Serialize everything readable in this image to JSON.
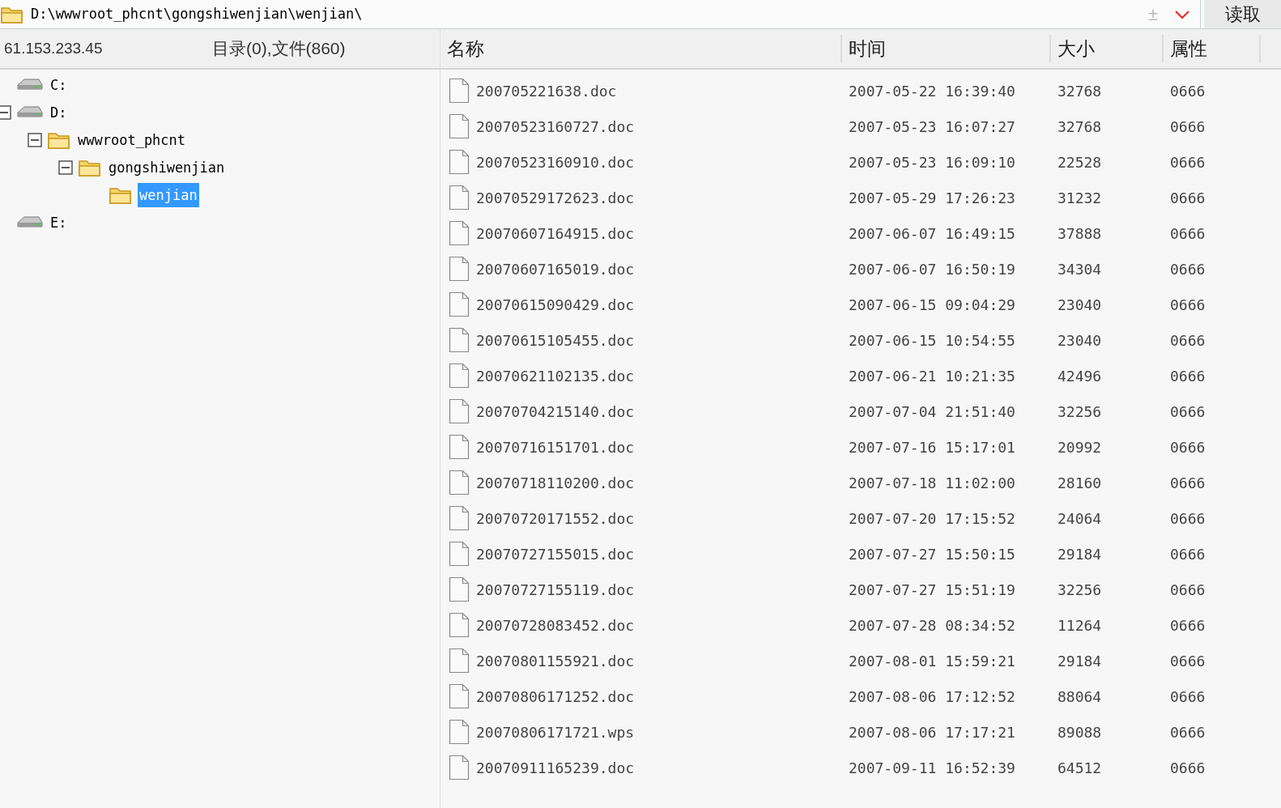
{
  "address_bar": {
    "path": "D:\\wwwroot_phcnt\\gongshiwenjian\\wenjian\\",
    "toggle_symbol": "±",
    "read_button": "读取"
  },
  "left_header": {
    "host": "61.153.233.45",
    "summary": "目录(0),文件(860)"
  },
  "tree": [
    {
      "label": "C:",
      "kind": "drive",
      "expanded": false,
      "selected": false
    },
    {
      "label": "D:",
      "kind": "drive",
      "expanded": true,
      "selected": false,
      "children": [
        {
          "label": "wwwroot_phcnt",
          "kind": "folder",
          "expanded": true,
          "selected": false,
          "children": [
            {
              "label": "gongshiwenjian",
              "kind": "folder",
              "expanded": true,
              "selected": false,
              "children": [
                {
                  "label": "wenjian",
                  "kind": "folder",
                  "expanded": false,
                  "selected": true
                }
              ]
            }
          ]
        }
      ]
    },
    {
      "label": "E:",
      "kind": "drive",
      "expanded": false,
      "selected": false
    }
  ],
  "table": {
    "columns": [
      "名称",
      "时间",
      "大小",
      "属性"
    ],
    "rows": [
      [
        "200705221638.doc",
        "2007-05-22 16:39:40",
        "32768",
        "0666"
      ],
      [
        "20070523160727.doc",
        "2007-05-23 16:07:27",
        "32768",
        "0666"
      ],
      [
        "20070523160910.doc",
        "2007-05-23 16:09:10",
        "22528",
        "0666"
      ],
      [
        "20070529172623.doc",
        "2007-05-29 17:26:23",
        "31232",
        "0666"
      ],
      [
        "20070607164915.doc",
        "2007-06-07 16:49:15",
        "37888",
        "0666"
      ],
      [
        "20070607165019.doc",
        "2007-06-07 16:50:19",
        "34304",
        "0666"
      ],
      [
        "20070615090429.doc",
        "2007-06-15 09:04:29",
        "23040",
        "0666"
      ],
      [
        "20070615105455.doc",
        "2007-06-15 10:54:55",
        "23040",
        "0666"
      ],
      [
        "20070621102135.doc",
        "2007-06-21 10:21:35",
        "42496",
        "0666"
      ],
      [
        "20070704215140.doc",
        "2007-07-04 21:51:40",
        "32256",
        "0666"
      ],
      [
        "20070716151701.doc",
        "2007-07-16 15:17:01",
        "20992",
        "0666"
      ],
      [
        "20070718110200.doc",
        "2007-07-18 11:02:00",
        "28160",
        "0666"
      ],
      [
        "20070720171552.doc",
        "2007-07-20 17:15:52",
        "24064",
        "0666"
      ],
      [
        "20070727155015.doc",
        "2007-07-27 15:50:15",
        "29184",
        "0666"
      ],
      [
        "20070727155119.doc",
        "2007-07-27 15:51:19",
        "32256",
        "0666"
      ],
      [
        "20070728083452.doc",
        "2007-07-28 08:34:52",
        "11264",
        "0666"
      ],
      [
        "20070801155921.doc",
        "2007-08-01 15:59:21",
        "29184",
        "0666"
      ],
      [
        "20070806171252.doc",
        "2007-08-06 17:12:52",
        "88064",
        "0666"
      ],
      [
        "20070806171721.wps",
        "2007-08-06 17:17:21",
        "89088",
        "0666"
      ],
      [
        "20070911165239.doc",
        "2007-09-11 16:52:39",
        "64512",
        "0666"
      ]
    ]
  }
}
